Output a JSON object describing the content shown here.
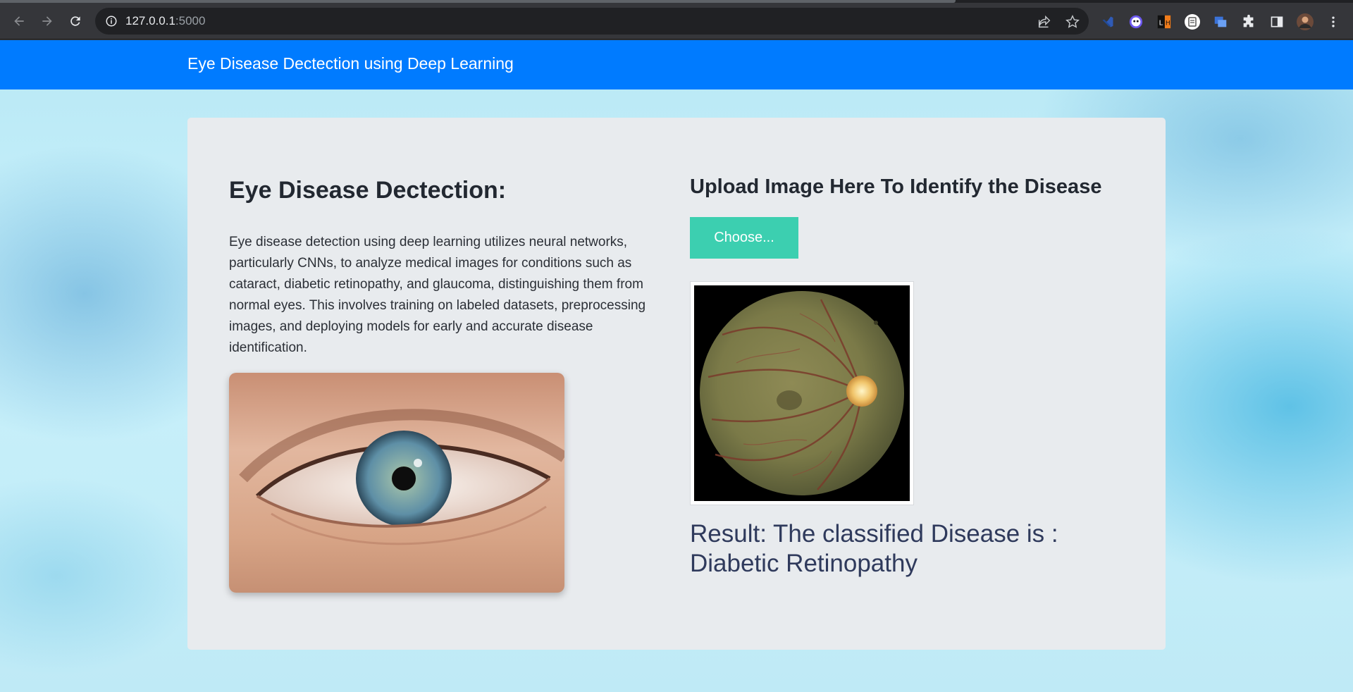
{
  "browser": {
    "url_host": "127.0.0.1",
    "url_port": ":5000"
  },
  "navbar": {
    "brand": "Eye Disease Dectection using Deep Learning"
  },
  "left": {
    "title": "Eye Disease Dectection:",
    "description": "Eye disease detection using deep learning utilizes neural networks, particularly CNNs, to analyze medical images for conditions such as cataract, diabetic retinopathy, and glaucoma, distinguishing them from normal eyes. This involves training on labeled datasets, preprocessing images, and deploying models for early and accurate disease identification."
  },
  "right": {
    "title": "Upload Image Here To Identify the Disease",
    "choose_label": "Choose...",
    "result_line1": "Result: The classified Disease is :",
    "result_line2": "Diabetic Retinopathy"
  },
  "colors": {
    "navbar": "#007bff",
    "button": "#3ccfb0",
    "result_text": "#2f3a5c"
  }
}
